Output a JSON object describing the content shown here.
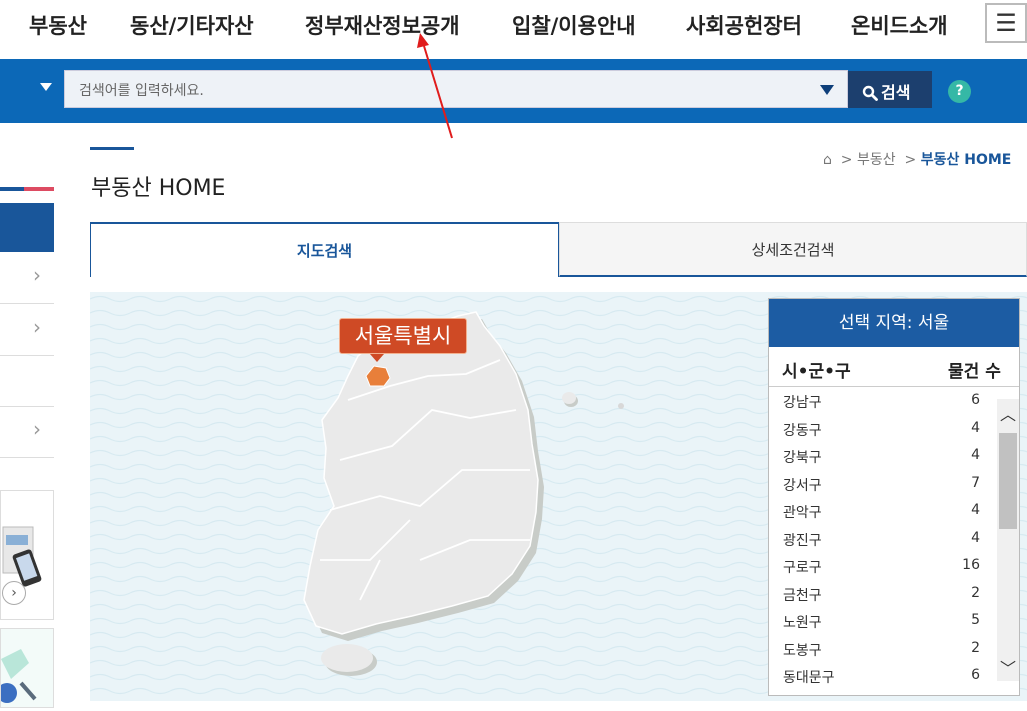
{
  "nav": {
    "items": [
      "부동산",
      "동산/기타자산",
      "정부재산정보공개",
      "입찰/이용안내",
      "사회공헌장터",
      "온비드소개"
    ],
    "menu_icon": "hamburger-icon"
  },
  "search": {
    "placeholder": "검색어를 입력하세요.",
    "button_label": "검색",
    "help_label": "?"
  },
  "page": {
    "title": "부동산 HOME",
    "breadcrumb": [
      "부동산",
      "부동산 HOME"
    ]
  },
  "tabs": [
    "지도검색",
    "상세조건검색"
  ],
  "map": {
    "callout": "서울특별시",
    "highlight_color": "#e87f3a",
    "callout_color": "#cf4a25"
  },
  "region_panel": {
    "header": "선택 지역: 서울",
    "col_name": "시•군•구",
    "col_count": "물건 수",
    "rows": [
      {
        "name": "강남구",
        "count": "6"
      },
      {
        "name": "강동구",
        "count": "4"
      },
      {
        "name": "강북구",
        "count": "4"
      },
      {
        "name": "강서구",
        "count": "7"
      },
      {
        "name": "관악구",
        "count": "4"
      },
      {
        "name": "광진구",
        "count": "4"
      },
      {
        "name": "구로구",
        "count": "16"
      },
      {
        "name": "금천구",
        "count": "2"
      },
      {
        "name": "노원구",
        "count": "5"
      },
      {
        "name": "도봉구",
        "count": "2"
      },
      {
        "name": "동대문구",
        "count": "6"
      }
    ]
  },
  "colors": {
    "primary_blue": "#0c68b7",
    "dark_blue": "#1c3f6e",
    "help_green": "#35b8a6"
  }
}
